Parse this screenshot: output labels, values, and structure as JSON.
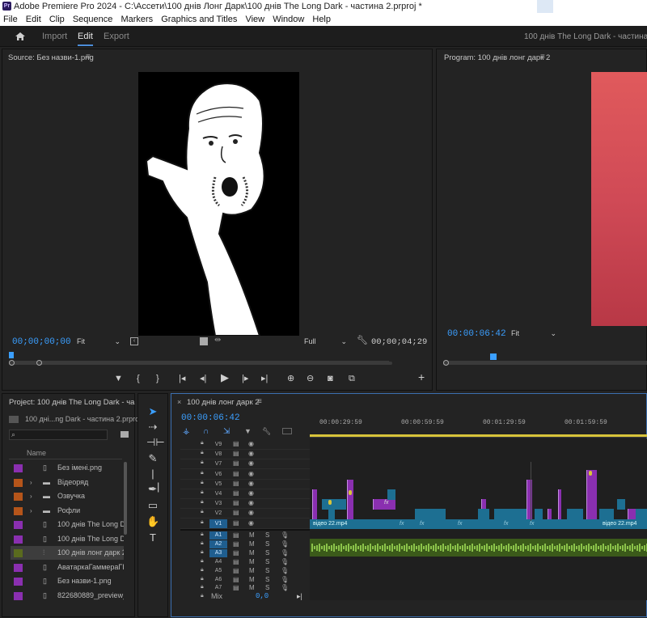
{
  "title_bar": {
    "app_icon": "Pr",
    "text": "Adobe Premiere Pro 2024 - C:\\Ассети\\100 днів Лонг Дарк\\100 днів The Long Dark - частина 2.prproj *"
  },
  "menu": [
    "File",
    "Edit",
    "Clip",
    "Sequence",
    "Markers",
    "Graphics and Titles",
    "View",
    "Window",
    "Help"
  ],
  "workspace": {
    "tabs": [
      "Import",
      "Edit",
      "Export"
    ],
    "active": "Edit",
    "project_name": "100 днів The Long Dark - частина 2"
  },
  "source": {
    "title": "Source: Без назви-1.png",
    "timecode": "00;00;00;00",
    "zoom": "Fit",
    "quality": "Full",
    "duration": "00;00;04;29"
  },
  "program": {
    "title": "Program: 100 днів лонг дарк 2",
    "timecode": "00:00:06:42",
    "zoom": "Fit"
  },
  "project": {
    "title": "Project: 100 днів The Long Dark - ча",
    "file": "100 дні...ng Dark - частина 2.prproj",
    "column": "Name",
    "items": [
      {
        "name": "Без імені.png",
        "color": "#8a2fb0",
        "type": "file"
      },
      {
        "name": "Відеоряд",
        "color": "#b5551a",
        "type": "folder"
      },
      {
        "name": "Озвучка",
        "color": "#b5551a",
        "type": "folder"
      },
      {
        "name": "Рофли",
        "color": "#b5551a",
        "type": "folder"
      },
      {
        "name": "100 днів The Long Dar",
        "color": "#8a2fb0",
        "type": "file"
      },
      {
        "name": "100 днів The Long Dar",
        "color": "#8a2fb0",
        "type": "file"
      },
      {
        "name": "100 днів лонг дарк 2",
        "color": "#5a6b1e",
        "type": "sequence"
      },
      {
        "name": "АватаркаГаммераГІФ.g",
        "color": "#8a2fb0",
        "type": "file"
      },
      {
        "name": "Без назви-1.png",
        "color": "#8a2fb0",
        "type": "file"
      },
      {
        "name": "822680889_preview_",
        "color": "#8a2fb0",
        "type": "file"
      }
    ]
  },
  "timeline": {
    "tab": "100 днів лонг дарк 2",
    "timecode": "00:00:06:42",
    "ruler": [
      "00:00:29:59",
      "00:00:59:59",
      "00:01:29:59",
      "00:01:59:59"
    ],
    "video_tracks": [
      "V9",
      "V8",
      "V7",
      "V6",
      "V5",
      "V4",
      "V3",
      "V2",
      "V1"
    ],
    "audio_tracks": [
      "A1",
      "A2",
      "A3",
      "A4",
      "A5",
      "A6",
      "A7"
    ],
    "mix_label": "Mix",
    "mix_value": "0,0",
    "clip_label": "відео 22.mp4",
    "clip_label_2": "відео 22.mp4",
    "fx": "fx"
  },
  "colors": {
    "accent": "#3b9fff",
    "clip_blue": "#1d6f92",
    "clip_purple": "#8a2fb0",
    "clip_green": "#7ba83c"
  }
}
